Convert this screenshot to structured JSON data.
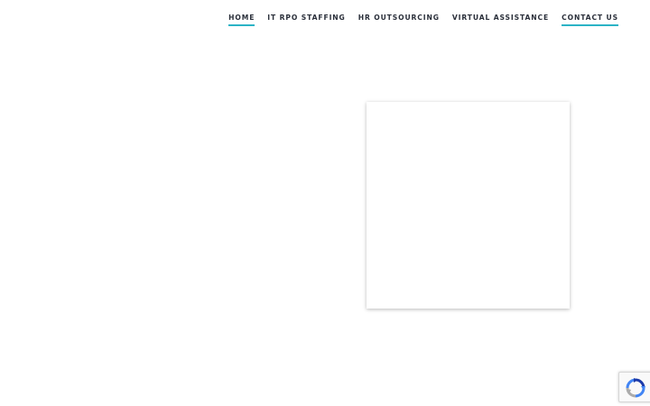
{
  "nav": {
    "items": [
      {
        "label": "HOME",
        "active": true
      },
      {
        "label": "IT RPO STAFFING",
        "active": false
      },
      {
        "label": "HR OUTSOURCING",
        "active": false
      },
      {
        "label": "VIRTUAL ASSISTANCE",
        "active": false
      },
      {
        "label": "CONTACT US",
        "active": true
      }
    ]
  },
  "recaptcha": {
    "icon": "recaptcha-icon"
  },
  "colors": {
    "accent": "#2bb3c6",
    "nav_text": "#2a2f3a",
    "background": "#ffffff"
  }
}
